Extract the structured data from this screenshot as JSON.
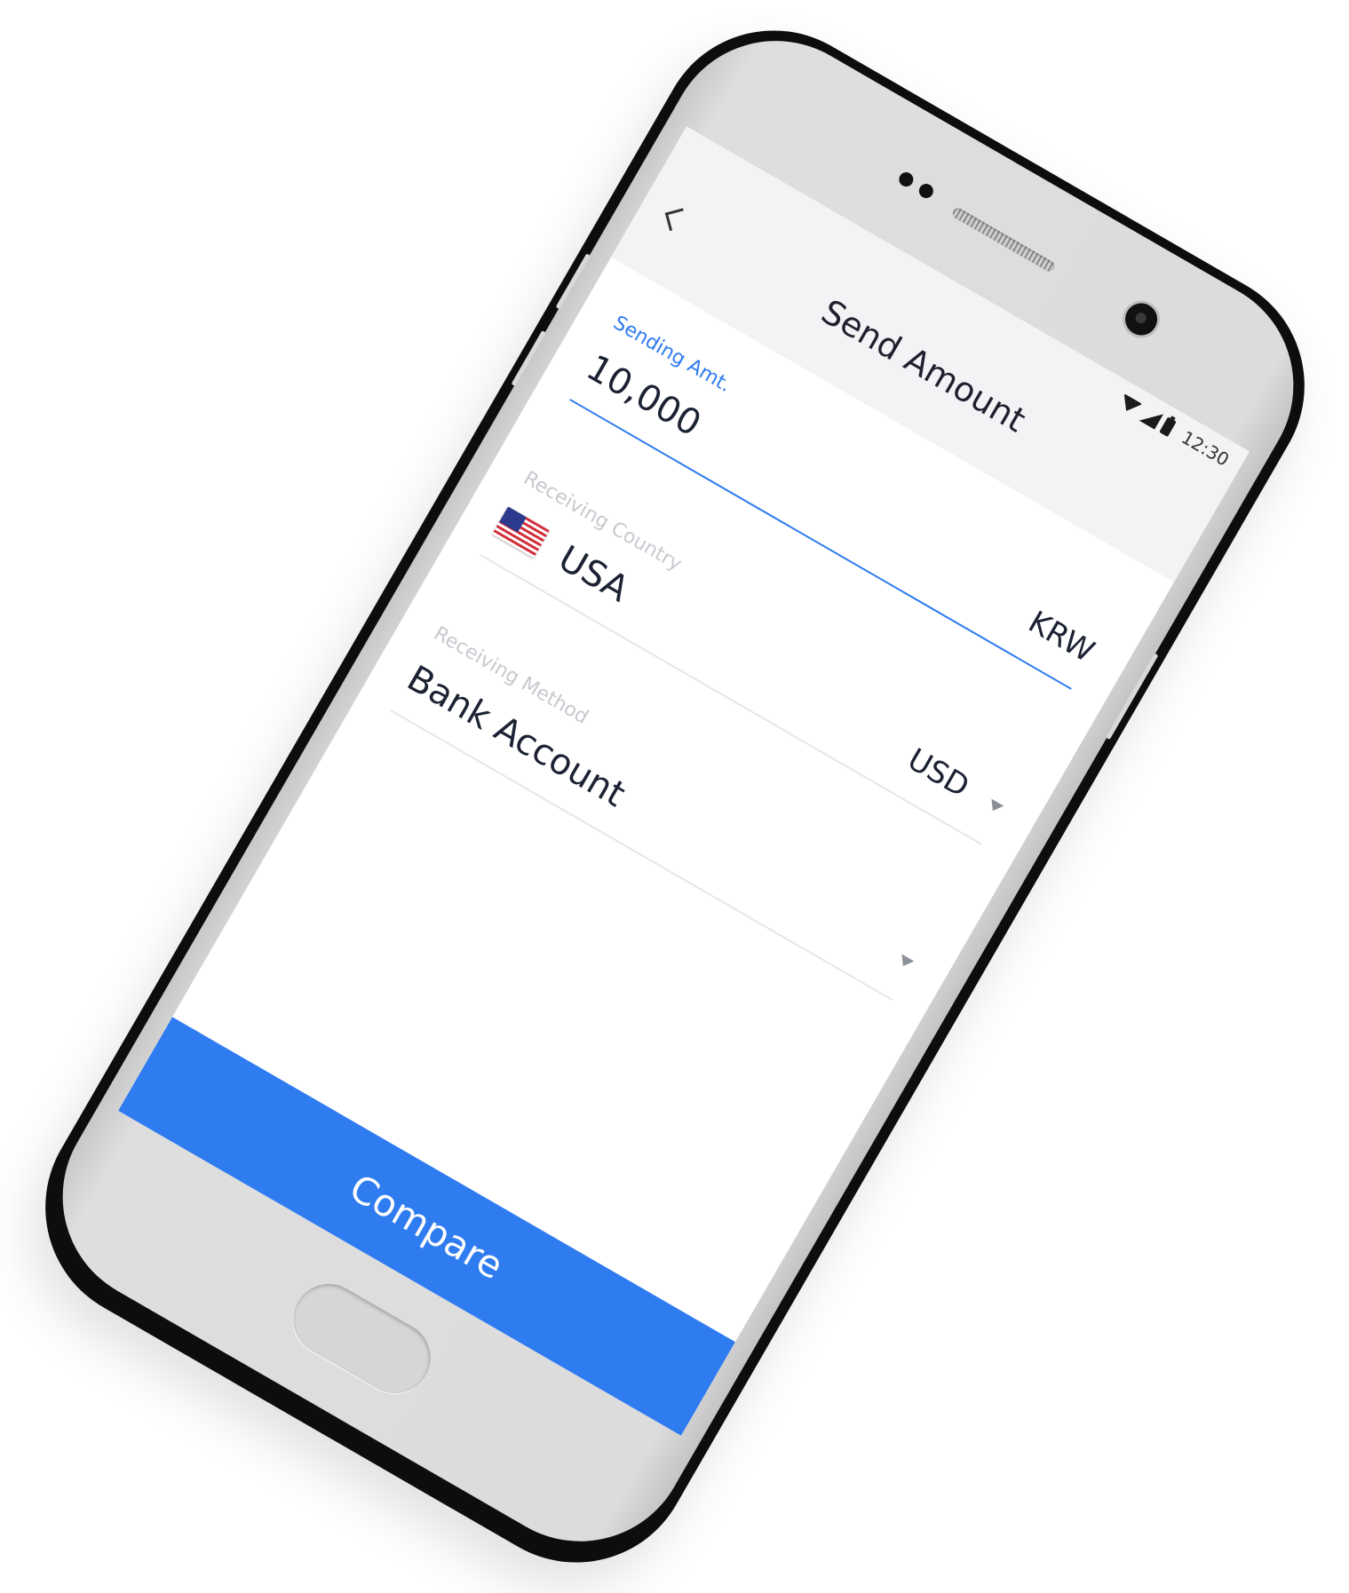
{
  "status_bar": {
    "time": "12:30"
  },
  "header": {
    "title": "Send Amount",
    "back_icon": "chevron-left-icon"
  },
  "form": {
    "sending_amount": {
      "label": "Sending Amt.",
      "value": "10,000",
      "currency": "KRW"
    },
    "receiving_country": {
      "label": "Receiving Country",
      "value": "USA",
      "flag": "us-flag-icon",
      "currency": "USD"
    },
    "receiving_method": {
      "label": "Receiving Method",
      "value": "Bank Account"
    }
  },
  "actions": {
    "compare_label": "Compare"
  },
  "colors": {
    "accent": "#2f7bf0",
    "text": "#1c2233",
    "muted_label": "#c7c9cf",
    "divider": "#e6e7ea",
    "header_bg": "#f2f3f5"
  }
}
